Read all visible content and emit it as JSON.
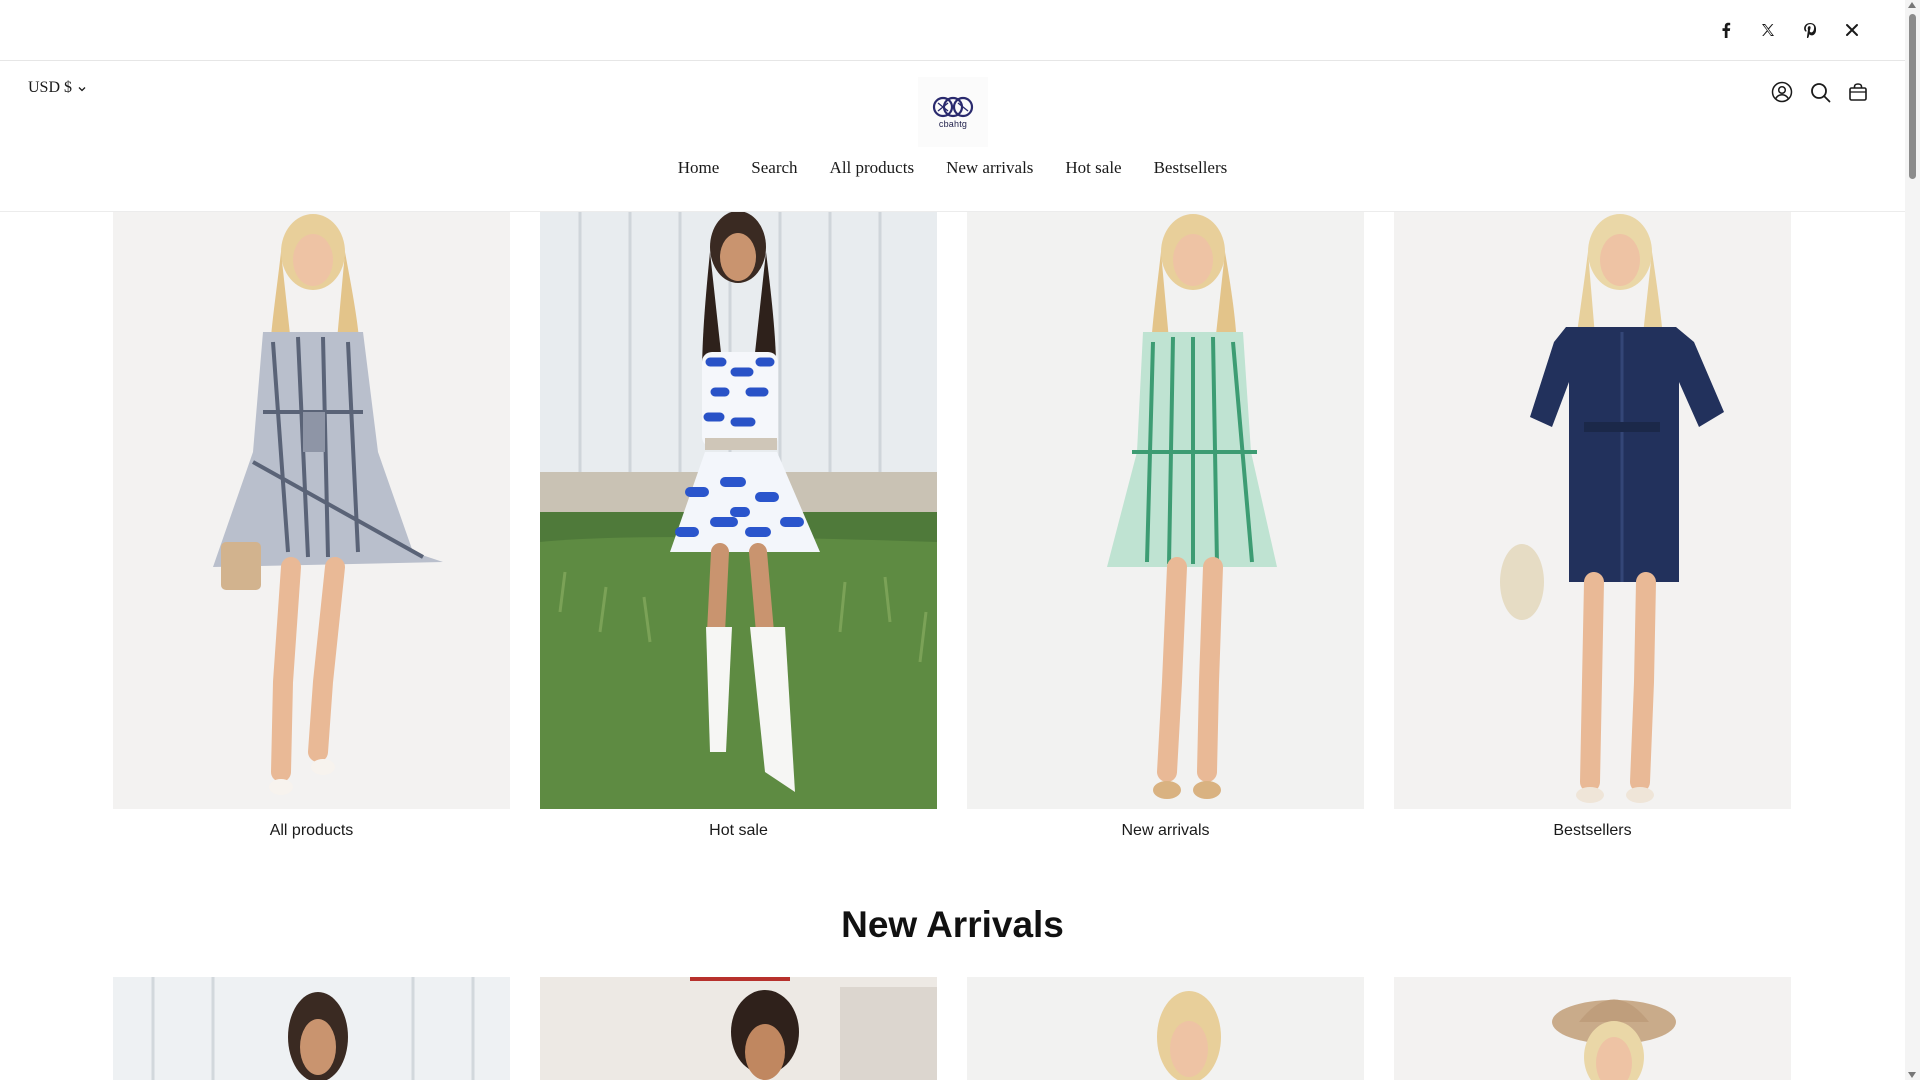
{
  "topbar": {
    "social": [
      {
        "name": "facebook-icon"
      },
      {
        "name": "x-twitter-icon"
      },
      {
        "name": "pinterest-icon"
      },
      {
        "name": "close-icon"
      }
    ]
  },
  "header": {
    "currency": "USD $",
    "logo_text": "cbahtg",
    "icons": [
      "account-icon",
      "search-icon",
      "cart-icon"
    ]
  },
  "nav": {
    "items": [
      "Home",
      "Search",
      "All products",
      "New arrivals",
      "Hot sale",
      "Bestsellers"
    ]
  },
  "collections": [
    {
      "label": "All products",
      "image": "model-grey-striped-shirt-dress"
    },
    {
      "label": "Hot sale",
      "image": "model-blue-floral-strapless-dress-white-boots"
    },
    {
      "label": "New arrivals",
      "image": "model-green-striped-shirt-dress"
    },
    {
      "label": "Bestsellers",
      "image": "model-navy-eyelet-shirt-dress"
    }
  ],
  "new_arrivals": {
    "title": "New Arrivals",
    "products": [
      {
        "image": "model-dark-hair-white-wall"
      },
      {
        "image": "model-dark-hair-updo"
      },
      {
        "image": "model-blonde-light-background"
      },
      {
        "image": "model-blonde-cowboy-hat"
      }
    ]
  },
  "colors": {
    "text": "#1a1a1a",
    "border": "#e6e6e6",
    "logo": "#2a2a6e"
  }
}
